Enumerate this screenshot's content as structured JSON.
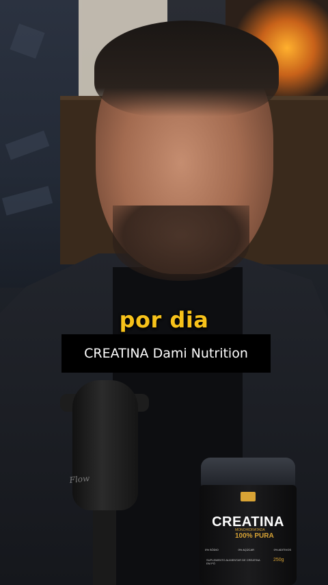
{
  "caption": {
    "text": "por dia",
    "color": "#f7c21a"
  },
  "product_label": {
    "text": "CREATINA Dami Nutrition"
  },
  "microphone": {
    "brand": "Flow"
  },
  "product_jar": {
    "title": "CREATINA",
    "subtitle": "MONOHIDRATADA",
    "purity": "100% PURA",
    "facts": [
      "0% SÓDIO",
      "0% AÇÚCAR",
      "0% ADITIVOS"
    ],
    "description": "SUPLEMENTO ALIMENTAR DE CREATINA EM PÓ",
    "weight": "250g",
    "accent_color": "#d8a335"
  }
}
